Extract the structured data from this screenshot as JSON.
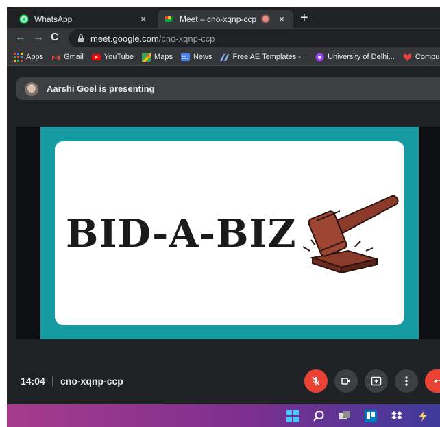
{
  "browser": {
    "tabs": [
      {
        "label": "WhatsApp",
        "icon": "whatsapp-icon",
        "active": false
      },
      {
        "label": "Meet – cno-xqnp-ccp",
        "icon": "google-meet-icon",
        "active": true,
        "recording": true
      }
    ],
    "close_glyph": "×",
    "new_tab_glyph": "+",
    "address": {
      "host": "meet.google.com",
      "path": "/cno-xqnp-ccp"
    },
    "bookmarks": [
      {
        "label": "Apps",
        "icon": "apps-grid-icon",
        "color": "#4285f4"
      },
      {
        "label": "Gmail",
        "icon": "gmail-icon",
        "color": "#ea4335"
      },
      {
        "label": "YouTube",
        "icon": "youtube-icon",
        "color": "#ff0000"
      },
      {
        "label": "Maps",
        "icon": "maps-icon",
        "color": "#34a853"
      },
      {
        "label": "News",
        "icon": "google-news-icon",
        "color": "#4285f4"
      },
      {
        "label": "Free AE Templates -...",
        "icon": "ae-templates-icon",
        "color": "#8ab4f8"
      },
      {
        "label": "University of Delhi...",
        "icon": "university-icon",
        "color": "#a142f4"
      },
      {
        "label": "Compu",
        "icon": "heart-icon",
        "color": "#ea4335"
      }
    ]
  },
  "meet": {
    "presenter_text": "Aarshi Goel is presenting",
    "slide": {
      "title": "BID-A-BIZ",
      "frame_color": "#179ba3",
      "image": "gavel-icon"
    },
    "time": "14:04",
    "meeting_code": "cno-xqnp-ccp",
    "controls": [
      {
        "name": "mic-off-button",
        "icon": "mic-off-icon"
      },
      {
        "name": "camera-button",
        "icon": "camera-icon"
      },
      {
        "name": "present-button",
        "icon": "present-icon"
      },
      {
        "name": "more-options-button",
        "icon": "more-vert-icon"
      },
      {
        "name": "leave-call-button",
        "icon": "end-call-icon"
      }
    ]
  },
  "taskbar": {
    "icons": [
      "windows-start-icon",
      "search-icon",
      "task-view-icon",
      "trello-icon",
      "dropbox-icon",
      "arrow-icon"
    ]
  },
  "colors": {
    "accent_red": "#ea4335",
    "dark_bg": "#202124",
    "panel": "#3c4043"
  }
}
